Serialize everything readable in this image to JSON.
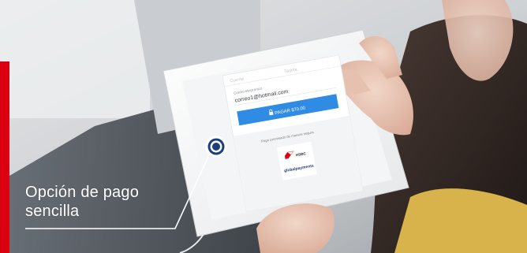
{
  "caption": {
    "line1": "Opción de pago",
    "line2": "sencilla"
  },
  "form": {
    "tab_left": "Cuenta",
    "tab_right": "Tarjeta",
    "email_label": "Correo electrónico",
    "email_value": "correo1@hotmail.com",
    "pay_button": "PAGAR $70.00",
    "secure_text": "Pago procesado de manera segura"
  },
  "logos": {
    "brand_top": "HSBC",
    "brand_bottom": "globalpayments"
  },
  "colors": {
    "accent_red": "#db0011",
    "pay_blue": "#2f8be3",
    "marker_blue": "#1c3f82",
    "caption_text": "#ffffff"
  },
  "icons": {
    "marker": "target-marker-icon",
    "lock": "lock-icon"
  }
}
